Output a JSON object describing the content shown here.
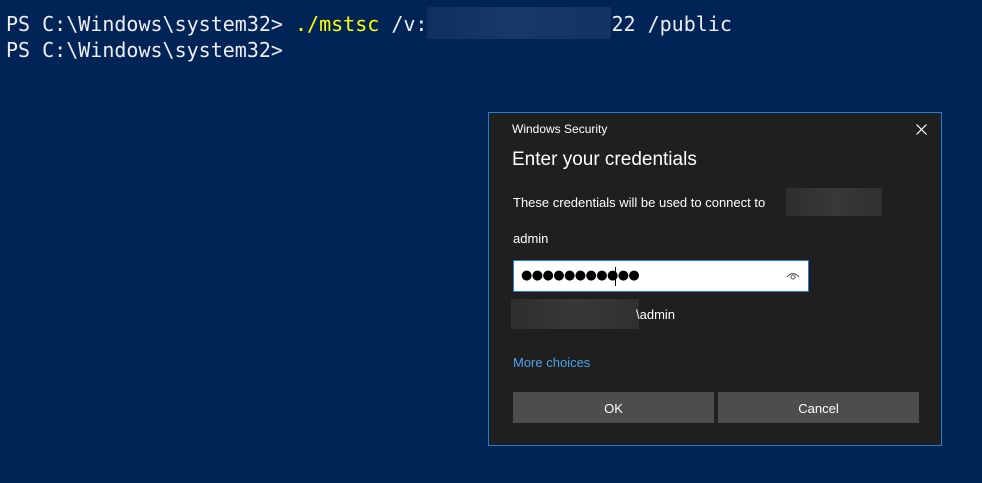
{
  "terminal": {
    "line1": {
      "prompt": "PS C:\\Windows\\system32> ",
      "command": "./mstsc",
      "arg_prefix": " /v:",
      "arg_suffix": "22 /public"
    },
    "line2": {
      "prompt": "PS C:\\Windows\\system32>"
    },
    "background_color": "#012456",
    "text_color": "#eeedf0",
    "command_color": "#ffff00"
  },
  "dialog": {
    "window_title": "Windows Security",
    "heading": "Enter your credentials",
    "description": "These credentials will be used to connect to",
    "username": "admin",
    "password_masked": "●●●●●●●●●●●",
    "domain_username_suffix": "\\admin",
    "more_choices_label": "More choices",
    "ok_label": "OK",
    "cancel_label": "Cancel",
    "accent_color": "#1e7fd4",
    "link_color": "#4aa3e8",
    "icons": {
      "close": "close-icon",
      "reveal": "eye-icon"
    }
  }
}
